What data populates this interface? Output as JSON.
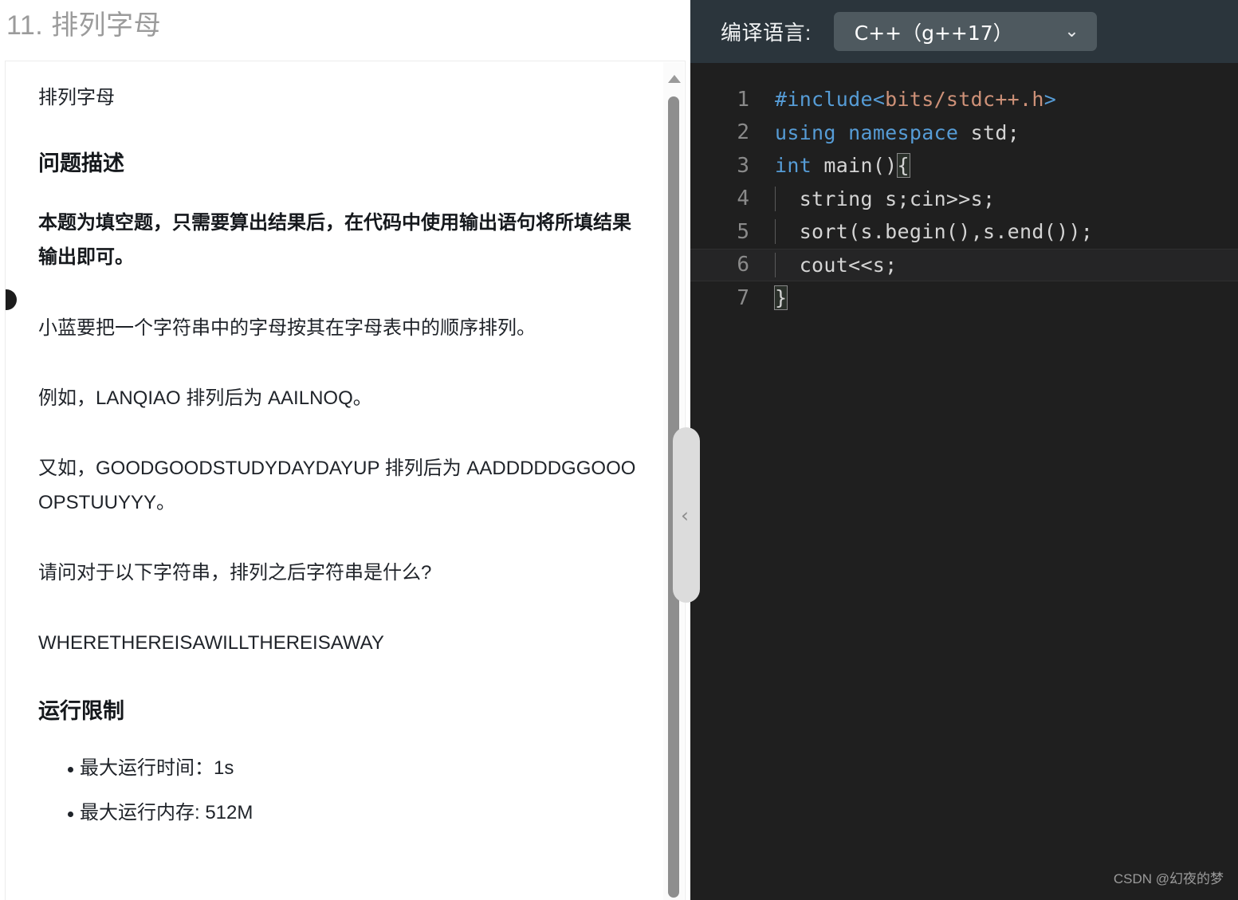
{
  "page_title": "11. 排列字母",
  "document": {
    "subtitle": "排列字母",
    "heading_description": "问题描述",
    "note": "本题为填空题，只需要算出结果后，在代码中使用输出语句将所填结果输出即可。",
    "paragraph_1": "小蓝要把一个字符串中的字母按其在字母表中的顺序排列。",
    "paragraph_2": "例如，LANQIAO 排列后为 AAILNOQ。",
    "paragraph_3": "又如，GOODGOODSTUDYDAYDAYUP 排列后为 AADDDDDGGOOOOPSTUUYYY。",
    "paragraph_4": "请问对于以下字符串，排列之后字符串是什么?",
    "input_string": "WHERETHEREISAWILLTHEREISAWAY",
    "heading_limits": "运行限制",
    "limits": [
      "最大运行时间：1s",
      "最大运行内存: 512M"
    ]
  },
  "scrollbar": {
    "up_arrow_icon": "triangle-up-icon",
    "thumb_color": "#8e8e8e"
  },
  "collapse_handle": {
    "icon": "chevron-left-icon",
    "glyph": "‹"
  },
  "editor": {
    "language_label": "编译语言:",
    "language_value": "C++（g++17）",
    "caret_glyph": "⌄",
    "active_line": 6,
    "lines": [
      {
        "num": "1",
        "tokens": [
          {
            "t": "#include",
            "c": "kw"
          },
          {
            "t": "<",
            "c": "kw"
          },
          {
            "t": "bits/stdc++.h",
            "c": "str"
          },
          {
            "t": ">",
            "c": "kw"
          }
        ]
      },
      {
        "num": "2",
        "tokens": [
          {
            "t": "using",
            "c": "kw"
          },
          {
            "t": " ",
            "c": "pln"
          },
          {
            "t": "namespace",
            "c": "kw"
          },
          {
            "t": " std;",
            "c": "pln"
          }
        ]
      },
      {
        "num": "3",
        "tokens": [
          {
            "t": "int",
            "c": "kw"
          },
          {
            "t": " main()",
            "c": "pln"
          },
          {
            "t": "{",
            "c": "bracket-box"
          }
        ]
      },
      {
        "num": "4",
        "tokens": [
          {
            "t": "  string s;cin>>s;",
            "c": "pln"
          }
        ]
      },
      {
        "num": "5",
        "tokens": [
          {
            "t": "  sort(s.begin(),s.end());",
            "c": "pln"
          }
        ]
      },
      {
        "num": "6",
        "tokens": [
          {
            "t": "  cout<<s;",
            "c": "pln"
          }
        ]
      },
      {
        "num": "7",
        "tokens": [
          {
            "t": "}",
            "c": "bracket-box"
          }
        ]
      }
    ]
  },
  "watermark": "CSDN @幻夜的梦"
}
